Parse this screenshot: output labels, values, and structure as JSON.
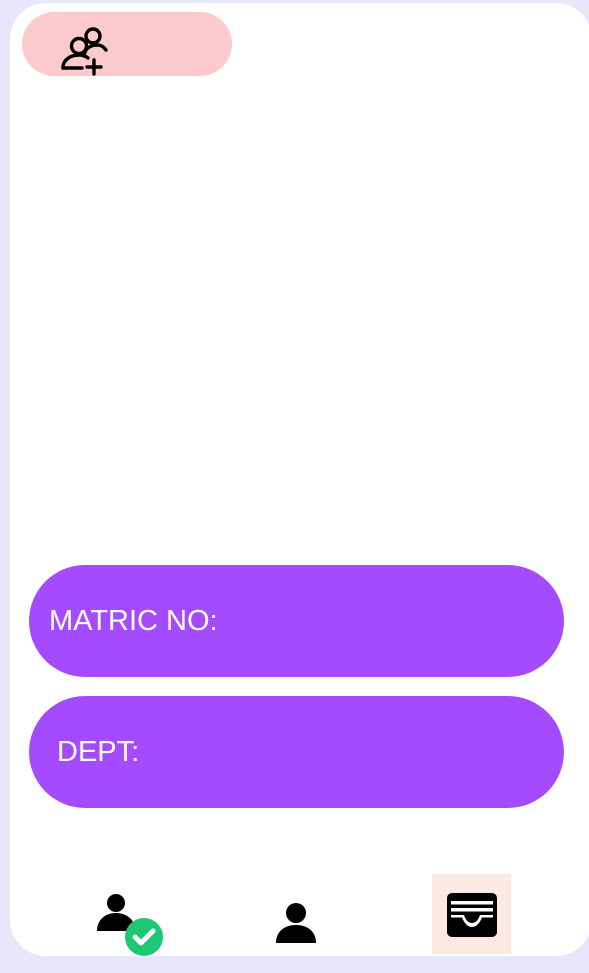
{
  "app": {
    "theme": {
      "background": "#e8e6fb",
      "card": "#ffffff",
      "accent": "#a54bff",
      "pill": "#fccaca",
      "active_tab_bg": "#fbe9e2",
      "check": "#1ec773"
    }
  },
  "header": {
    "add_user_icon": "add-users-icon"
  },
  "fields": {
    "matric_label": "MATRIC NO:",
    "dept_label": "DEPT:"
  },
  "nav": {
    "items": [
      {
        "icon": "user-verified-icon"
      },
      {
        "icon": "user-icon"
      },
      {
        "icon": "wallet-icon",
        "active": true
      }
    ]
  }
}
